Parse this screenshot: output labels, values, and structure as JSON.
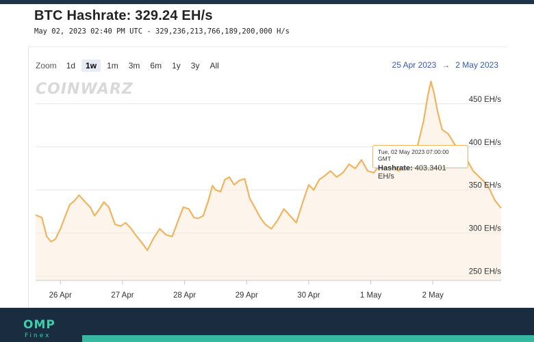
{
  "header": {
    "title": "BTC Hashrate: 329.24 EH/s",
    "subtitle": "May 02, 2023 02:40 PM UTC - 329,236,213,766,189,200,000 H/s"
  },
  "toolbar": {
    "zoom_label": "Zoom",
    "buttons": [
      "1d",
      "1w",
      "1m",
      "3m",
      "6m",
      "1y",
      "3y",
      "All"
    ],
    "active": "1w"
  },
  "range": {
    "from": "25 Apr 2023",
    "arrow": "→",
    "to": "2 May 2023"
  },
  "watermark": "COINWARZ",
  "tooltip": {
    "date": "Tue, 02 May 2023 07:00:00 GMT",
    "label": "Hashrate:",
    "value": "403.3401 EH/s"
  },
  "footer": {
    "logo": "OMP",
    "sub": "Finex"
  },
  "colors": {
    "line": "#f0b35e",
    "fill": "#fbeedd",
    "footer": "#1a2d40",
    "accent": "#36b9a0",
    "link": "#335cad"
  },
  "chart_data": {
    "type": "area",
    "xlim": [
      -0.4,
      7.1
    ],
    "ylim": [
      245,
      480
    ],
    "y_ticks": [
      250,
      300,
      350,
      400,
      450
    ],
    "y_tick_labels": [
      "250 EH/s",
      "300 EH/s",
      "350 EH/s",
      "400 EH/s",
      "450 EH/s"
    ],
    "x_ticks": [
      0,
      1,
      2,
      3,
      4,
      5,
      6
    ],
    "x_tick_labels": [
      "26 Apr",
      "27 Apr",
      "28 Apr",
      "29 Apr",
      "30 Apr",
      "1 May",
      "2 May"
    ],
    "series": [
      {
        "x": [
          -0.4,
          -0.3,
          -0.22,
          -0.15,
          -0.08,
          0.0,
          0.08,
          0.15,
          0.22,
          0.3,
          0.4,
          0.48,
          0.55,
          0.62,
          0.7,
          0.78,
          0.88,
          0.97,
          1.05,
          1.13,
          1.22,
          1.3,
          1.4,
          1.5,
          1.6,
          1.7,
          1.8,
          1.9,
          1.98,
          2.07,
          2.15,
          2.22,
          2.3,
          2.38,
          2.45,
          2.5,
          2.58,
          2.65,
          2.72,
          2.8,
          2.88,
          2.97,
          3.05,
          3.13,
          3.22,
          3.3,
          3.4,
          3.5,
          3.6,
          3.7,
          3.8,
          3.9,
          4.0,
          4.08,
          4.17,
          4.25,
          4.35,
          4.45,
          4.55,
          4.65,
          4.75,
          4.85,
          4.95,
          5.05,
          5.15,
          5.25,
          5.35,
          5.45,
          5.55,
          5.65,
          5.75,
          5.85,
          5.92,
          5.97,
          6.02,
          6.08,
          6.15,
          6.25,
          6.35,
          6.45,
          6.55,
          6.65,
          6.75,
          6.85,
          6.92,
          7.0,
          7.1
        ],
        "y": [
          321,
          318,
          296,
          290,
          293,
          305,
          320,
          333,
          337,
          344,
          336,
          330,
          320,
          327,
          336,
          330,
          310,
          308,
          312,
          306,
          297,
          290,
          280,
          294,
          305,
          298,
          296,
          315,
          330,
          328,
          318,
          317,
          320,
          337,
          355,
          350,
          348,
          362,
          365,
          356,
          361,
          363,
          340,
          330,
          318,
          310,
          305,
          315,
          328,
          320,
          312,
          335,
          356,
          350,
          362,
          366,
          372,
          365,
          370,
          380,
          375,
          385,
          372,
          370,
          380,
          382,
          378,
          372,
          387,
          392,
          400,
          430,
          460,
          476,
          462,
          440,
          420,
          415,
          403,
          395,
          385,
          372,
          365,
          358,
          350,
          338,
          329
        ]
      }
    ]
  }
}
